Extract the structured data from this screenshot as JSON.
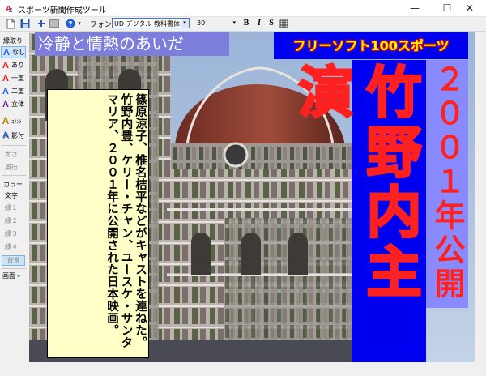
{
  "window": {
    "title": "スポーツ新聞作成ツール",
    "minimize": "—",
    "maximize": "☐",
    "close": "✕"
  },
  "toolbar": {
    "font_label": "フォント",
    "font_name": "UD デジタル 教科書体 NK",
    "font_size": "30",
    "bold": "B",
    "italic": "I",
    "strike": "S",
    "dropdown_arrow": "▾",
    "help_glyph": "?"
  },
  "sidebar": {
    "border_header": "縁取り",
    "border_items": [
      {
        "label": "なし",
        "icon_color": "#1e5fd8"
      },
      {
        "label": "あり",
        "icon_color": "#e02020"
      },
      {
        "label": "一重",
        "icon_color": "#e02020"
      },
      {
        "label": "二重",
        "icon_color": "#1e5fd8"
      },
      {
        "label": "立体",
        "icon_color": "#7030a0"
      }
    ],
    "comment": "ｺﾒﾝﾄ",
    "shadow": "影付",
    "thickness": "太さ",
    "depth": "奥行",
    "color_header": "カラー",
    "color_items": [
      "文字",
      "縁１",
      "縁２",
      "縁３",
      "縁４"
    ],
    "background": "背景",
    "screen": "画面"
  },
  "newspaper": {
    "headline_left": "冷静と情熱のあいだ",
    "headline_right": "フリーソフト100スポーツ",
    "caption": "篠原涼子、椎名桔平などがキャストを連ねた。竹野内豊、ケリー・チャン、ユースケ・サンタマリア、２００１年に公開された日本映画。",
    "main_title": "竹野内主演",
    "sub_title": "２００１年公開"
  },
  "colors": {
    "title_box": "#0000f0",
    "title_stroke": "#ff2020",
    "year_box": "#8a8aff",
    "caption_bg": "#ffffc8",
    "headline_left_bg": "#7d7ddc",
    "headline_right_text": "#ffff00"
  }
}
